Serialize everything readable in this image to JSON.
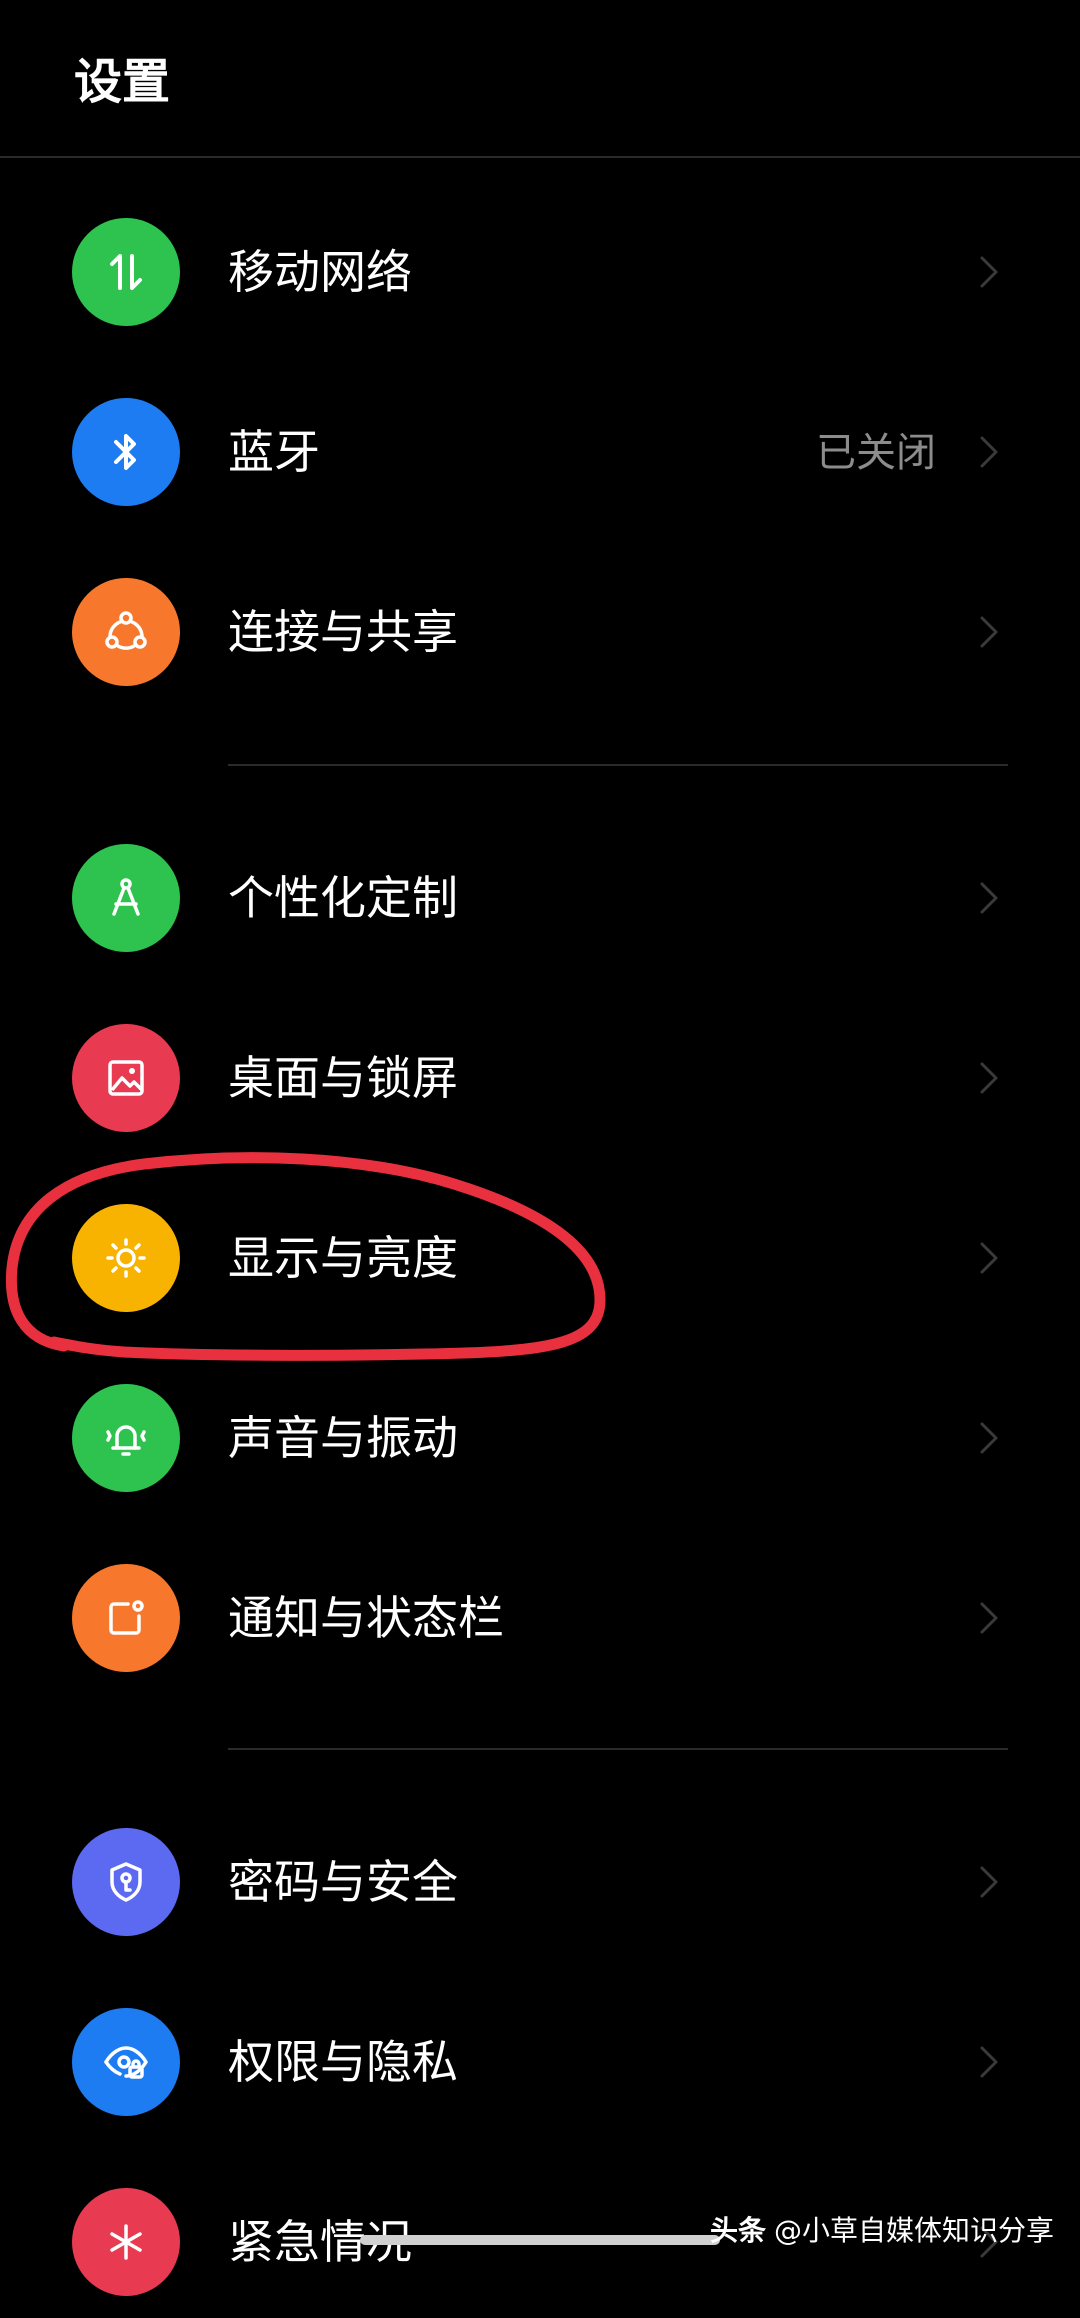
{
  "header": {
    "title": "设置"
  },
  "colors": {
    "background": "#000000",
    "annotation": "#e8303e",
    "green": "#2ec24f",
    "blue": "#1e7cf2",
    "orange": "#f7772c",
    "red": "#e83a50",
    "yellow": "#f7b300",
    "indigo": "#5b6af0"
  },
  "settings": {
    "items": [
      {
        "label": "移动网络",
        "icon": "mobile-data-icon",
        "value": ""
      },
      {
        "label": "蓝牙",
        "icon": "bluetooth-icon",
        "value": "已关闭"
      },
      {
        "label": "连接与共享",
        "icon": "share-connection-icon",
        "value": ""
      },
      {
        "label": "个性化定制",
        "icon": "compass-icon",
        "value": ""
      },
      {
        "label": "桌面与锁屏",
        "icon": "wallpaper-icon",
        "value": ""
      },
      {
        "label": "显示与亮度",
        "icon": "brightness-icon",
        "value": ""
      },
      {
        "label": "声音与振动",
        "icon": "bell-vibration-icon",
        "value": ""
      },
      {
        "label": "通知与状态栏",
        "icon": "notification-icon",
        "value": ""
      },
      {
        "label": "密码与安全",
        "icon": "shield-key-icon",
        "value": ""
      },
      {
        "label": "权限与隐私",
        "icon": "privacy-eye-icon",
        "value": ""
      },
      {
        "label": "紧急情况",
        "icon": "emergency-icon",
        "value": ""
      }
    ]
  },
  "watermark": {
    "brand": "头条",
    "account": "@小草自媒体知识分享"
  }
}
